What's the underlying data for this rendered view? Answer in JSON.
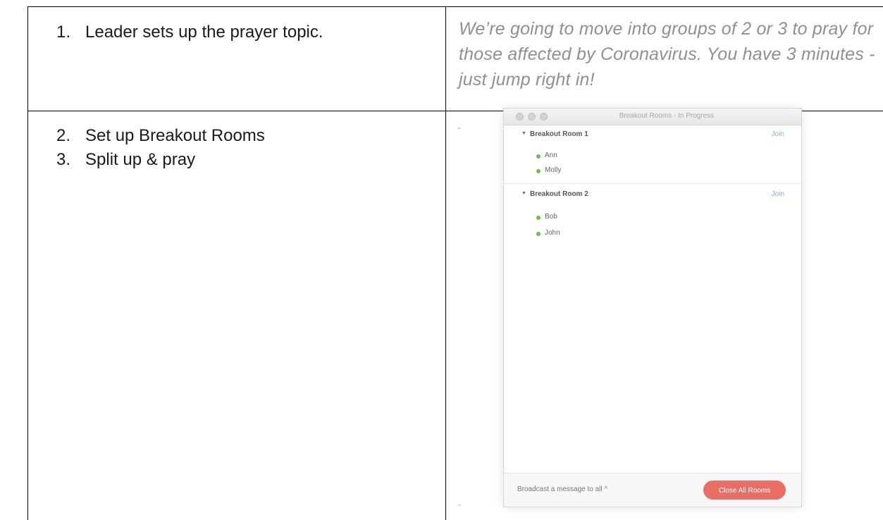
{
  "table": {
    "row1": {
      "steps": [
        {
          "num": "1.",
          "text": "Leader sets up the prayer topic."
        }
      ],
      "quote": "We’re going to move into groups of 2 or 3 to pray for those affected by Coronavirus. You have 3 minutes - just jump right in!"
    },
    "row2": {
      "steps": [
        {
          "num": "2.",
          "text": "Set up Breakout Rooms"
        },
        {
          "num": "3.",
          "text": "Split up & pray"
        }
      ]
    }
  },
  "zoom_window": {
    "title": "Breakout Rooms - In Progress",
    "rooms": [
      {
        "name": "Breakout Room 1",
        "join_label": "Join",
        "members": [
          "Ann",
          "Molly"
        ]
      },
      {
        "name": "Breakout Room 2",
        "join_label": "Join",
        "members": [
          "Bob",
          "John"
        ]
      }
    ],
    "broadcast_label": "Broadcast a message to all ^",
    "close_button_label": "Close All Rooms",
    "colors": {
      "member_dot": "#6cc04a",
      "close_button": "#e86f66",
      "join_link": "#8ab3d8"
    }
  }
}
